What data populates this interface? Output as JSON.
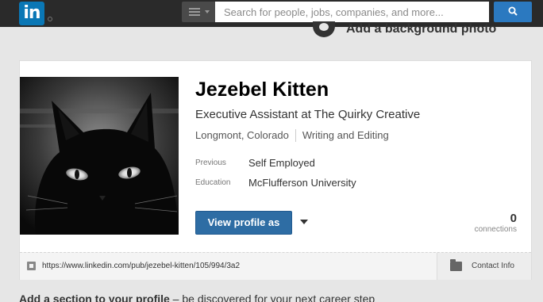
{
  "nav": {
    "logo_text": "in",
    "search_placeholder": "Search for people, jobs, companies, and more...",
    "search_button_icon": "search-icon",
    "menu_icon": "hamburger-menu-icon"
  },
  "background_photo": {
    "icon": "camera-icon",
    "label": "Add a background photo"
  },
  "profile": {
    "name": "Jezebel Kitten",
    "headline": "Executive Assistant at The Quirky Creative",
    "location": "Longmont, Colorado",
    "industry": "Writing and Editing",
    "previous_label": "Previous",
    "previous_value": "Self Employed",
    "education_label": "Education",
    "education_value": "McFlufferson University",
    "view_profile_label": "View profile as",
    "connections_count": "0",
    "connections_label": "connections",
    "public_url": "https://www.linkedin.com/pub/jezebel-kitten/105/994/3a2",
    "contact_info_label": "Contact Info"
  },
  "add_section": {
    "bold": "Add a section to your profile",
    "rest": " – be discovered for your next career step"
  },
  "colors": {
    "brand_blue": "#0a77b5",
    "button_blue": "#2e6da4",
    "nav_dark": "#2a2a2a"
  }
}
